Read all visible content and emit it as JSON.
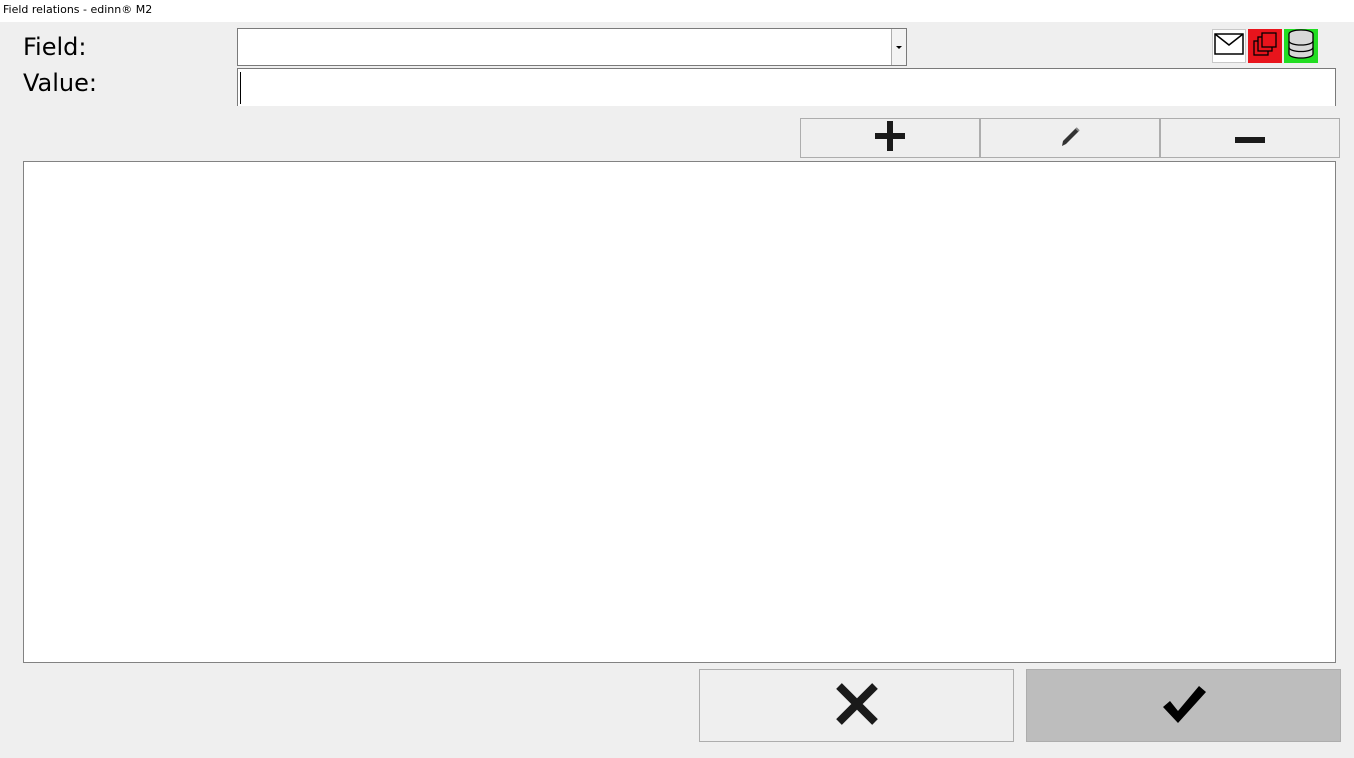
{
  "window": {
    "title": "Field relations - edinn® M2"
  },
  "form": {
    "field_label": "Field:",
    "field_value": "",
    "value_label": "Value:",
    "value_value": ""
  },
  "header_icons": [
    {
      "name": "mail-icon",
      "bg": "#ffffff"
    },
    {
      "name": "windows-icon",
      "bg": "#e8141c"
    },
    {
      "name": "database-icon",
      "bg": "#22dd22"
    }
  ],
  "toolbar": {
    "buttons": [
      "add-icon",
      "edit-icon",
      "remove-icon"
    ]
  },
  "list": {
    "items": []
  },
  "dialog_buttons": [
    "cancel-icon",
    "confirm-icon"
  ]
}
